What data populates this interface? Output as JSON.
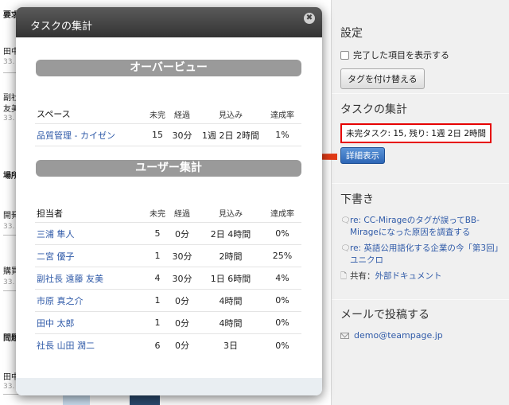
{
  "background": {
    "lines": [
      "要求",
      "田中",
      "33.",
      "副社",
      "友美",
      "33.",
      "場所",
      "開発",
      "33.",
      "購買",
      "33.",
      "問題",
      "田中",
      "33."
    ]
  },
  "sidebar": {
    "settings": {
      "title": "設定",
      "show_completed_label": "完了した項目を表示する",
      "retag_button": "タグを付け替える"
    },
    "task_summary": {
      "title": "タスクの集計",
      "summary_text": "未完タスク: 15, 残り: 1週 2日 2時間",
      "details_button": "詳細表示"
    },
    "drafts": {
      "title": "下書き",
      "items": [
        {
          "icon": "comment-icon",
          "text": "re: CC-Mirageのタグが誤ってBB-Mirageになった原因を調査する",
          "prefix": ""
        },
        {
          "icon": "comment-icon",
          "text": "re: 英語公用語化する企業の今「第3回」ユニクロ",
          "prefix": ""
        },
        {
          "icon": "document-icon",
          "prefix": "共有：",
          "text": "外部ドキュメント"
        }
      ]
    },
    "email_post": {
      "title": "メールで投稿する",
      "address": "demo@teampage.jp"
    }
  },
  "modal": {
    "title": "タスクの集計",
    "overview": {
      "heading": "オーバービュー",
      "columns": [
        "スペース",
        "未完",
        "経過",
        "見込み",
        "達成率"
      ],
      "rows": [
        [
          "品質管理 - カイゼン",
          "15",
          "30分",
          "1週 2日 2時間",
          "1%"
        ]
      ]
    },
    "user_summary": {
      "heading": "ユーザー集計",
      "columns": [
        "担当者",
        "未完",
        "経過",
        "見込み",
        "達成率"
      ],
      "rows": [
        [
          "三浦 隼人",
          "5",
          "0分",
          "2日 4時間",
          "0%"
        ],
        [
          "二宮 優子",
          "1",
          "30分",
          "2時間",
          "25%"
        ],
        [
          "副社長 遠藤 友美",
          "4",
          "30分",
          "1日 6時間",
          "4%"
        ],
        [
          "市原 真之介",
          "1",
          "0分",
          "4時間",
          "0%"
        ],
        [
          "田中 太郎",
          "1",
          "0分",
          "4時間",
          "0%"
        ],
        [
          "社長 山田 潤二",
          "6",
          "0分",
          "3日",
          "0%"
        ]
      ]
    }
  },
  "colors": {
    "highlight_border": "#e60000",
    "arrow": "#e23a16",
    "link": "#2f5aa8",
    "modal_header": "#3f3f3f"
  }
}
